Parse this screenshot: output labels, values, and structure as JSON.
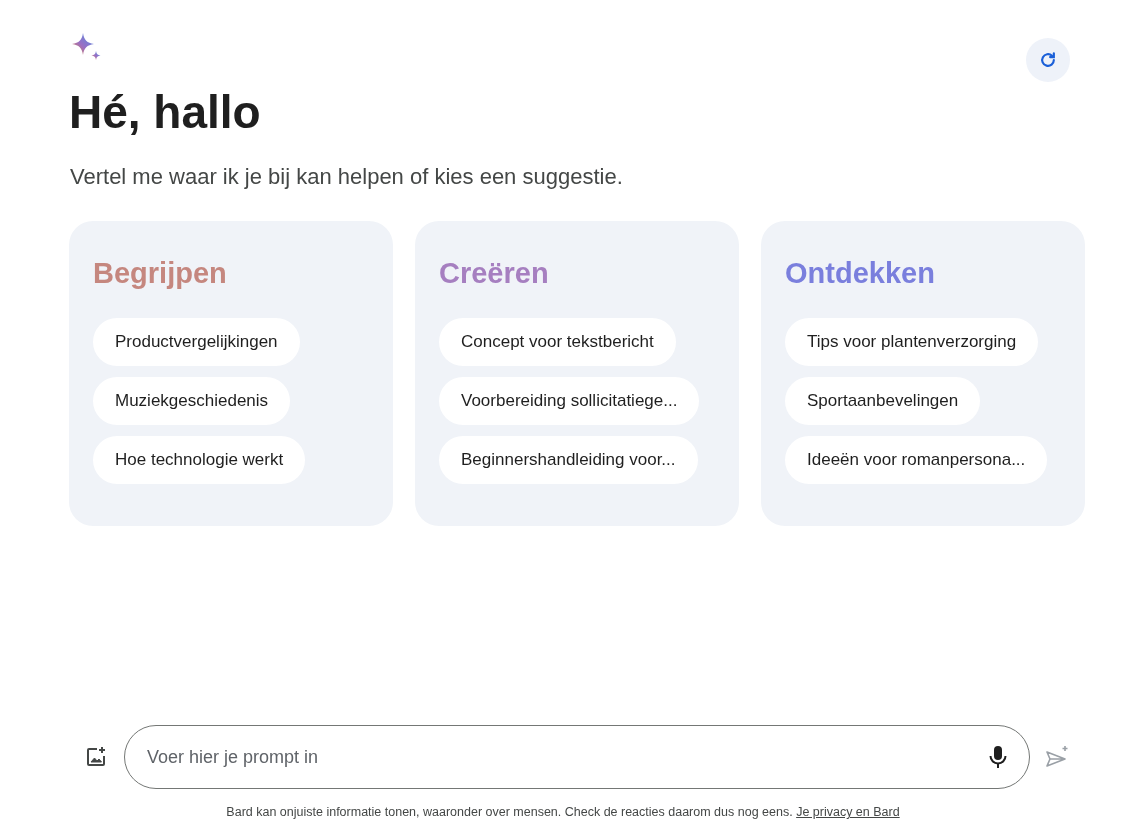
{
  "greeting": "Hé, hallo",
  "subtitle": "Vertel me waar ik je bij kan helpen of kies een suggestie.",
  "cards": [
    {
      "title": "Begrijpen",
      "color": "#c5877f",
      "suggestions": [
        "Productvergelijkingen",
        "Muziekgeschiedenis",
        "Hoe technologie werkt"
      ]
    },
    {
      "title": "Creëren",
      "color": "#a67fc0",
      "suggestions": [
        "Concept voor tekstbericht",
        "Voorbereiding sollicitatiege...",
        "Beginnershandleiding voor..."
      ]
    },
    {
      "title": "Ontdekken",
      "color": "#7a7fdd",
      "suggestions": [
        "Tips voor plantenverzorging",
        "Sportaanbevelingen",
        "Ideeën voor romanpersona..."
      ]
    }
  ],
  "prompt": {
    "placeholder": "Voer hier je prompt in"
  },
  "disclaimer": {
    "text": "Bard kan onjuiste informatie tonen, waaronder over mensen. Check de reacties daarom dus nog eens.",
    "link": "Je privacy en Bard"
  }
}
